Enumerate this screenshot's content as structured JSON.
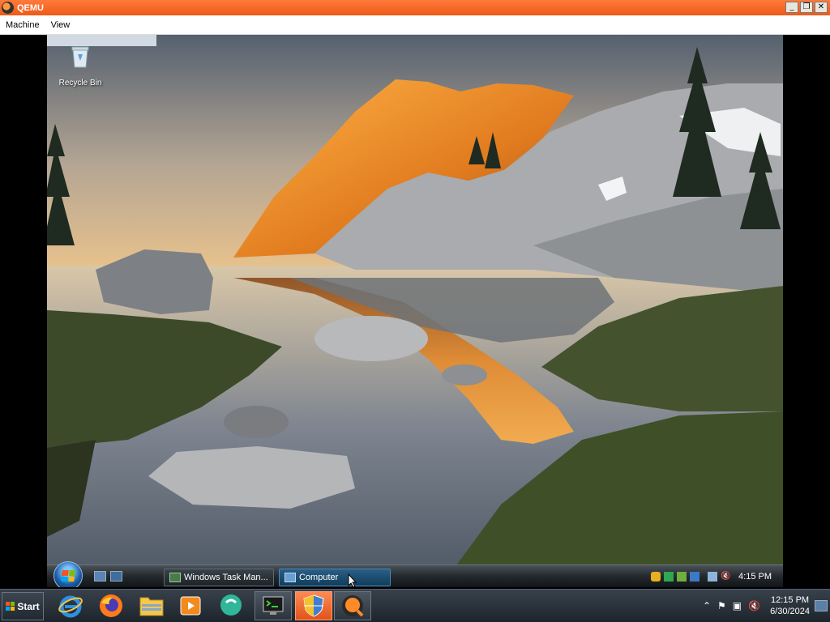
{
  "window": {
    "title": "QEMU",
    "controls": {
      "minimize": "_",
      "restore": "❐",
      "close": "✕"
    }
  },
  "menu": {
    "items": [
      "Machine",
      "View"
    ]
  },
  "guest": {
    "desktop_icons": [
      {
        "label": "Recycle Bin",
        "icon": "recycle-bin-icon"
      }
    ],
    "taskbar": {
      "quick_launch": [
        "show-desktop-icon",
        "switch-windows-icon"
      ],
      "buttons": [
        {
          "label": "Windows Task Man...",
          "icon": "task-manager-icon",
          "active": false
        },
        {
          "label": "Computer",
          "icon": "computer-icon",
          "active": true
        }
      ],
      "tray_icons": [
        "shield-warning-icon",
        "green-app-icon",
        "network-status-icon",
        "display-icon",
        "network-icon",
        "volume-muted-icon"
      ],
      "clock": "4:15 PM"
    }
  },
  "host": {
    "start_label": "Start",
    "pinned": [
      {
        "name": "internet-explorer",
        "icon": "internet-explorer-icon"
      },
      {
        "name": "firefox",
        "icon": "firefox-icon"
      },
      {
        "name": "file-explorer",
        "icon": "folder-icon"
      },
      {
        "name": "media-player",
        "icon": "media-player-icon"
      },
      {
        "name": "chat-app",
        "icon": "chat-bubble-icon"
      },
      {
        "name": "terminal",
        "icon": "terminal-icon"
      },
      {
        "name": "security",
        "icon": "shield-icon"
      },
      {
        "name": "qemu",
        "icon": "qemu-icon"
      }
    ],
    "tray": {
      "icons": [
        "show-hidden-icon",
        "action-center-flag-icon",
        "network-icon",
        "volume-muted-icon"
      ],
      "time": "12:15 PM",
      "date": "6/30/2024"
    }
  },
  "colors": {
    "qemu_titlebar": "#ef5a16",
    "host_taskbar": "#1d242c",
    "guest_taskbar": "#24292d",
    "active_task_button": "#2a5f86"
  }
}
